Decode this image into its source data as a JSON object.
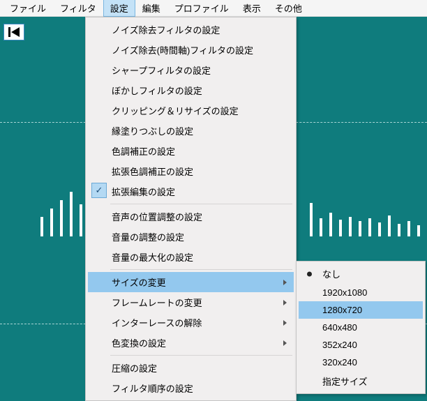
{
  "menubar": {
    "items": [
      "ファイル",
      "フィルタ",
      "設定",
      "編集",
      "プロファイル",
      "表示",
      "その他"
    ],
    "activeIndex": 2
  },
  "toolbar": {
    "jumpStart": "jump-start"
  },
  "menu": {
    "groups": [
      [
        {
          "label": "ノイズ除去フィルタの設定"
        },
        {
          "label": "ノイズ除去(時間軸)フィルタの設定"
        },
        {
          "label": "シャープフィルタの設定"
        },
        {
          "label": "ぼかしフィルタの設定"
        },
        {
          "label": "クリッピング＆リサイズの設定"
        },
        {
          "label": "縁塗りつぶしの設定"
        },
        {
          "label": "色調補正の設定"
        },
        {
          "label": "拡張色調補正の設定"
        },
        {
          "label": "拡張編集の設定",
          "checked": true
        }
      ],
      [
        {
          "label": "音声の位置調整の設定"
        },
        {
          "label": "音量の調整の設定"
        },
        {
          "label": "音量の最大化の設定"
        }
      ],
      [
        {
          "label": "サイズの変更",
          "submenu": true,
          "highlight": true
        },
        {
          "label": "フレームレートの変更",
          "submenu": true
        },
        {
          "label": "インターレースの解除",
          "submenu": true
        },
        {
          "label": "色変換の設定",
          "submenu": true
        }
      ],
      [
        {
          "label": "圧縮の設定"
        },
        {
          "label": "フィルタ順序の設定"
        }
      ]
    ],
    "submenu": [
      {
        "label": "なし",
        "selected": true
      },
      {
        "label": "1920x1080"
      },
      {
        "label": "1280x720",
        "highlight": true
      },
      {
        "label": "640x480"
      },
      {
        "label": "352x240"
      },
      {
        "label": "320x240"
      },
      {
        "label": "指定サイズ"
      }
    ]
  }
}
